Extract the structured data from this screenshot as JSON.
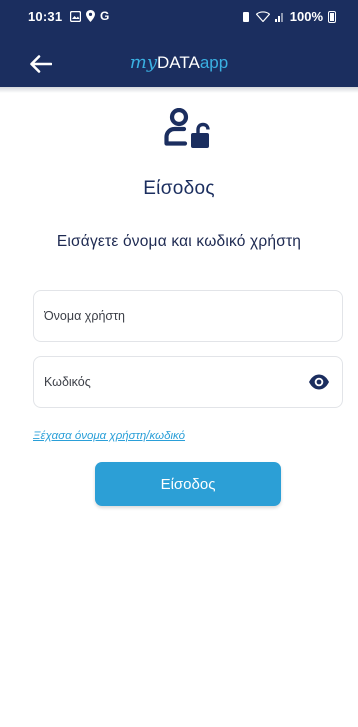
{
  "status_bar": {
    "time": "10:31",
    "left_icons": [
      "gallery-icon",
      "location-icon"
    ],
    "carrier_letter": "G",
    "battery_percent": "100%"
  },
  "app_bar": {
    "logo_my": "my",
    "logo_data": "DATA",
    "logo_app": "app"
  },
  "login": {
    "title": "Είσοδος",
    "subtitle": "Εισάγετε όνομα και κωδικό χρήστη",
    "username_placeholder": "Όνομα χρήστη",
    "password_placeholder": "Κωδικός",
    "forgot_link": "Ξέχασα όνομα χρήστη/κωδικό",
    "submit_label": "Είσοδος"
  },
  "colors": {
    "header": "#1b2e5f",
    "accent": "#2c9fd6",
    "title": "#1b2e5f"
  }
}
